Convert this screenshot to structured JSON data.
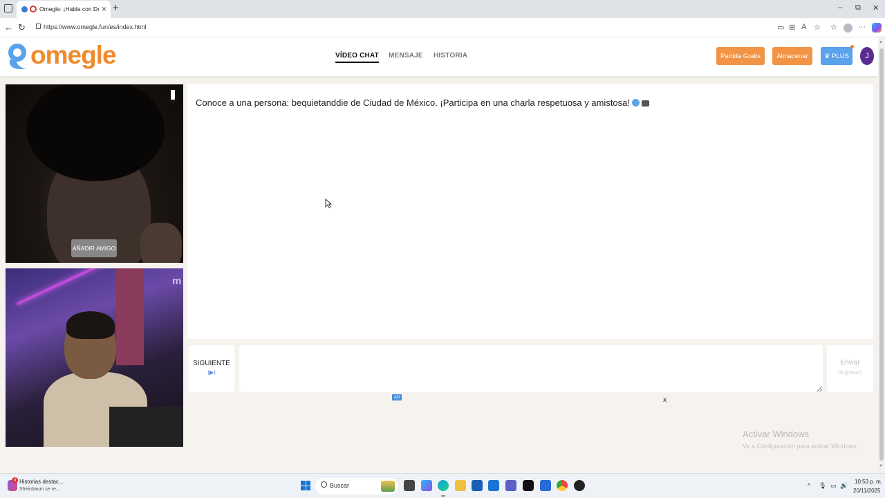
{
  "browser": {
    "tab_title": "Omegle: ¡Habla con Descono",
    "url": "https://www.omegle.fun/es/index.html",
    "new_tab": "+",
    "tab_close": "×",
    "window": {
      "minimize": "–",
      "restore": "⧉",
      "close": "✕"
    }
  },
  "header": {
    "logo_text": "omegle",
    "nav": [
      {
        "label": "VÍDEO CHAT",
        "active": true
      },
      {
        "label": "MENSAJE",
        "active": false
      },
      {
        "label": "HISTORIA",
        "active": false
      }
    ],
    "buttons": {
      "free_game": "Partida Gratis",
      "store": "Almacenar",
      "plus": "♛ PLUS"
    },
    "avatar_initial": "J"
  },
  "video": {
    "add_friend": "AÑADIR AMIGO",
    "self_mark": "m"
  },
  "chat": {
    "message": "Conoce a una persona: bequietanddie de Ciudad de México. ¡Participa en una charla respetuosa y amistosa!",
    "next_label": "SIGUIENTE",
    "next_hint": "(▶)",
    "input_value": "",
    "send_label": "Enviar",
    "send_hint": "(Ingresar)",
    "ad_badge": "AD",
    "ad_close": "x"
  },
  "watermark": {
    "title": "Activar Windows",
    "subtitle": "Ve a Configuración para activar Windows."
  },
  "taskbar": {
    "news_badge": "8",
    "news_title": "Historias destac...",
    "news_sub": "Sheinbaum se re...",
    "search_placeholder": "Buscar",
    "time": "10:53 p. m.",
    "date": "20/11/2025"
  },
  "colors": {
    "brand_orange": "#f08a2c",
    "button_orange": "#f29445",
    "plus_blue": "#5aa2ea",
    "avatar_purple": "#5b2c8e"
  }
}
